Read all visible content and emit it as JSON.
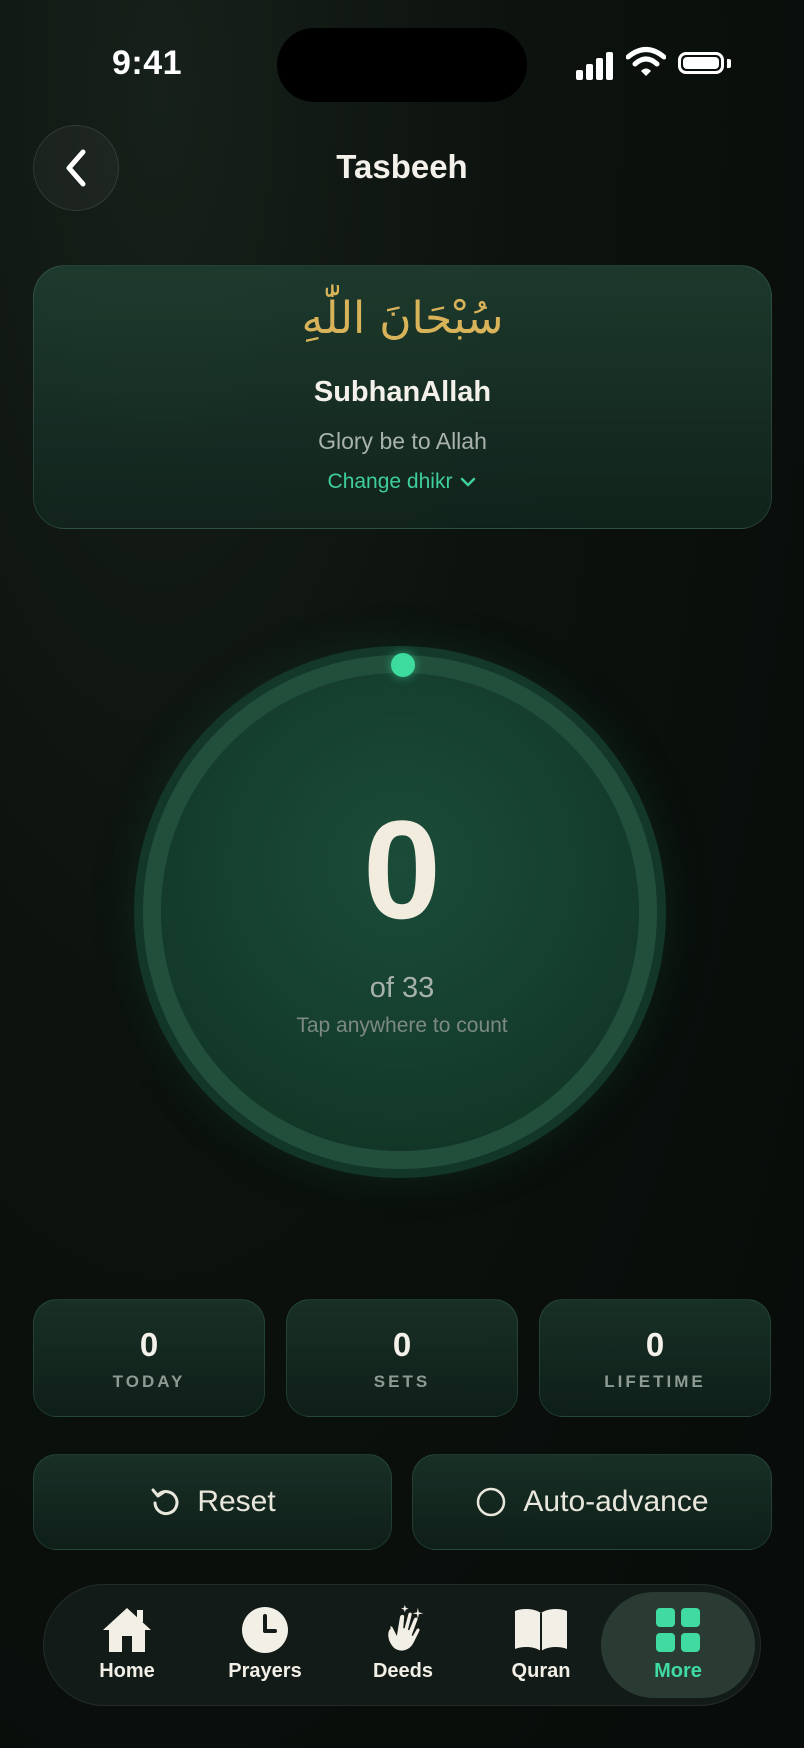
{
  "status_bar": {
    "time": "9:41"
  },
  "header": {
    "title": "Tasbeeh"
  },
  "dhikr": {
    "arabic": "سُبْحَانَ اللّٰهِ",
    "transliteration": "SubhanAllah",
    "meaning": "Glory be to Allah",
    "change_label": "Change dhikr"
  },
  "counter": {
    "count": "0",
    "goal_text": "of 33",
    "hint": "Tap anywhere to count",
    "progress": 0
  },
  "stats": [
    {
      "value": "0",
      "label": "TODAY"
    },
    {
      "value": "0",
      "label": "SETS"
    },
    {
      "value": "0",
      "label": "LIFETIME"
    }
  ],
  "actions": {
    "reset_label": "Reset",
    "auto_advance_label": "Auto-advance"
  },
  "tabs": [
    {
      "label": "Home",
      "icon": "home-icon"
    },
    {
      "label": "Prayers",
      "icon": "clock-icon"
    },
    {
      "label": "Deeds",
      "icon": "clapping-hands-icon"
    },
    {
      "label": "Quran",
      "icon": "book-icon"
    },
    {
      "label": "More",
      "icon": "grid-icon",
      "active": true
    }
  ],
  "colors": {
    "accent": "#3fdba1",
    "arabic_gold": "#d9b35a",
    "background": "#0a100d"
  }
}
